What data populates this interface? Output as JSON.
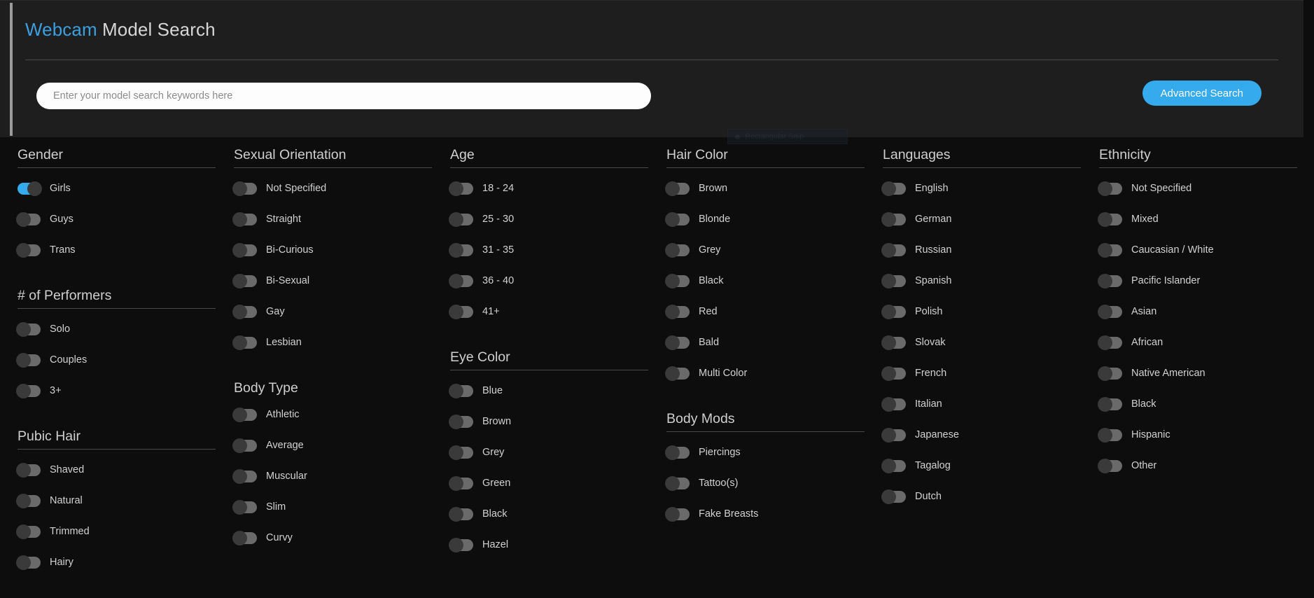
{
  "header": {
    "title_brand": "Webcam",
    "title_rest": " Model Search",
    "search": {
      "value": "",
      "placeholder": "Enter your model search keywords here"
    },
    "advanced_button_label": "Advanced Search",
    "accent_color": "#35abee",
    "brand_color": "#3c9fe0"
  },
  "overlay": {
    "snip_label": "Rectangular Snip"
  },
  "columns": [
    {
      "groups": [
        {
          "title": "Gender",
          "rule": true,
          "options": [
            {
              "label": "Girls",
              "on": true
            },
            {
              "label": "Guys",
              "on": false
            },
            {
              "label": "Trans",
              "on": false
            }
          ]
        },
        {
          "title": "# of Performers",
          "rule": true,
          "options": [
            {
              "label": "Solo",
              "on": false
            },
            {
              "label": "Couples",
              "on": false
            },
            {
              "label": "3+",
              "on": false
            }
          ]
        },
        {
          "title": "Pubic Hair",
          "rule": true,
          "options": [
            {
              "label": "Shaved",
              "on": false
            },
            {
              "label": "Natural",
              "on": false
            },
            {
              "label": "Trimmed",
              "on": false
            },
            {
              "label": "Hairy",
              "on": false
            }
          ]
        }
      ]
    },
    {
      "groups": [
        {
          "title": "Sexual Orientation",
          "rule": true,
          "options": [
            {
              "label": "Not Specified",
              "on": false
            },
            {
              "label": "Straight",
              "on": false
            },
            {
              "label": "Bi-Curious",
              "on": false
            },
            {
              "label": "Bi-Sexual",
              "on": false
            },
            {
              "label": "Gay",
              "on": false
            },
            {
              "label": "Lesbian",
              "on": false
            }
          ]
        },
        {
          "title": "Body Type",
          "rule": false,
          "options": [
            {
              "label": "Athletic",
              "on": false
            },
            {
              "label": "Average",
              "on": false
            },
            {
              "label": "Muscular",
              "on": false
            },
            {
              "label": "Slim",
              "on": false
            },
            {
              "label": "Curvy",
              "on": false
            }
          ]
        }
      ]
    },
    {
      "groups": [
        {
          "title": "Age",
          "rule": true,
          "options": [
            {
              "label": "18 - 24",
              "on": false
            },
            {
              "label": "25 - 30",
              "on": false
            },
            {
              "label": "31 - 35",
              "on": false
            },
            {
              "label": "36 - 40",
              "on": false
            },
            {
              "label": "41+",
              "on": false
            }
          ]
        },
        {
          "title": "Eye Color",
          "rule": true,
          "options": [
            {
              "label": "Blue",
              "on": false
            },
            {
              "label": "Brown",
              "on": false
            },
            {
              "label": "Grey",
              "on": false
            },
            {
              "label": "Green",
              "on": false
            },
            {
              "label": "Black",
              "on": false
            },
            {
              "label": "Hazel",
              "on": false
            }
          ]
        }
      ]
    },
    {
      "groups": [
        {
          "title": "Hair Color",
          "rule": true,
          "options": [
            {
              "label": "Brown",
              "on": false
            },
            {
              "label": "Blonde",
              "on": false
            },
            {
              "label": "Grey",
              "on": false
            },
            {
              "label": "Black",
              "on": false
            },
            {
              "label": "Red",
              "on": false
            },
            {
              "label": "Bald",
              "on": false
            },
            {
              "label": "Multi Color",
              "on": false
            }
          ]
        },
        {
          "title": "Body Mods",
          "rule": true,
          "options": [
            {
              "label": "Piercings",
              "on": false
            },
            {
              "label": "Tattoo(s)",
              "on": false
            },
            {
              "label": "Fake Breasts",
              "on": false
            }
          ]
        }
      ]
    },
    {
      "groups": [
        {
          "title": "Languages",
          "rule": true,
          "options": [
            {
              "label": "English",
              "on": false
            },
            {
              "label": "German",
              "on": false
            },
            {
              "label": "Russian",
              "on": false
            },
            {
              "label": "Spanish",
              "on": false
            },
            {
              "label": "Polish",
              "on": false
            },
            {
              "label": "Slovak",
              "on": false
            },
            {
              "label": "French",
              "on": false
            },
            {
              "label": "Italian",
              "on": false
            },
            {
              "label": "Japanese",
              "on": false
            },
            {
              "label": "Tagalog",
              "on": false
            },
            {
              "label": "Dutch",
              "on": false
            }
          ]
        }
      ]
    },
    {
      "groups": [
        {
          "title": "Ethnicity",
          "rule": true,
          "options": [
            {
              "label": "Not Specified",
              "on": false
            },
            {
              "label": "Mixed",
              "on": false
            },
            {
              "label": "Caucasian / White",
              "on": false
            },
            {
              "label": "Pacific Islander",
              "on": false
            },
            {
              "label": "Asian",
              "on": false
            },
            {
              "label": "African",
              "on": false
            },
            {
              "label": "Native American",
              "on": false
            },
            {
              "label": "Black",
              "on": false
            },
            {
              "label": "Hispanic",
              "on": false
            },
            {
              "label": "Other",
              "on": false
            }
          ]
        }
      ]
    }
  ]
}
